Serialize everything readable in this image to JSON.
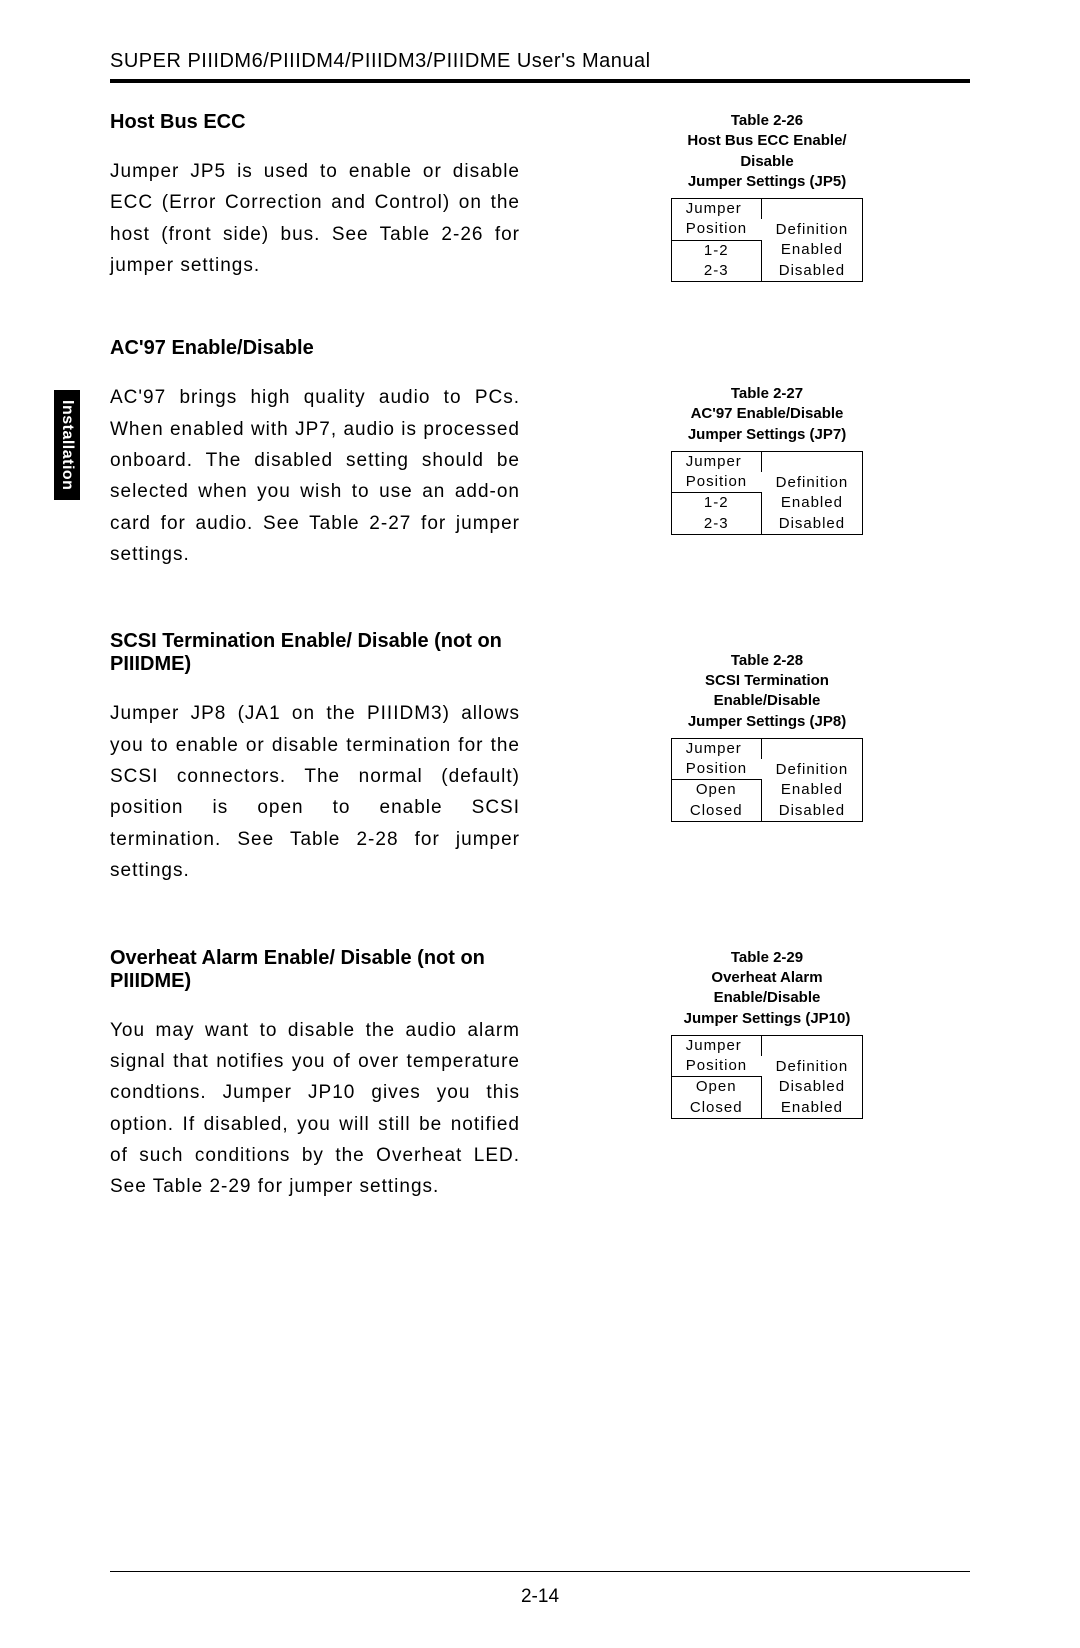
{
  "header": "SUPER PIIIDM6/PIIIDM4/PIIIDM3/PIIIDME User's Manual",
  "side_tab": "Installation",
  "page_number": "2-14",
  "sections": [
    {
      "title": "Host Bus ECC",
      "body": "Jumper JP5 is used to enable or disable ECC (Error Correction and Control) on the host (front side) bus.  See Table 2-26 for jumper settings."
    },
    {
      "title": "AC'97 Enable/Disable",
      "body": "AC'97 brings high quality audio to PCs.  When enabled with JP7, audio is processed onboard.  The disabled setting should be selected when you wish to use an add-on card for audio.  See Table 2-27 for jumper settings."
    },
    {
      "title": "SCSI Termination Enable/ Disable (not on PIIIDME)",
      "body": "Jumper JP8 (JA1 on the PIIIDM3) allows you to enable or disable termination for the SCSI connectors.  The normal (default) position is open to enable SCSI termination.  See Table 2-28 for jumper settings."
    },
    {
      "title": "Overheat Alarm Enable/ Disable (not on PIIIDME)",
      "body": "You may want to disable the audio alarm signal that notifies you of over temperature condtions.  Jumper JP10 gives you this option.  If disabled, you will still be notified of such conditions by the Overheat LED.  See Table 2-29 for jumper settings."
    }
  ],
  "tables": [
    {
      "caption_lines": [
        "Table 2-26",
        "Host Bus ECC Enable/",
        "Disable",
        "Jumper Settings (JP5)"
      ],
      "header": [
        "Jumper Position",
        "Definition"
      ],
      "rows": [
        [
          "1-2",
          "Enabled"
        ],
        [
          "2-3",
          "Disabled"
        ]
      ]
    },
    {
      "caption_lines": [
        "Table 2-27",
        "AC'97 Enable/Disable",
        "Jumper Settings (JP7)"
      ],
      "header": [
        "Jumper Position",
        "Definition"
      ],
      "rows": [
        [
          "1-2",
          "Enabled"
        ],
        [
          "2-3",
          "Disabled"
        ]
      ]
    },
    {
      "caption_lines": [
        "Table 2-28",
        "SCSI Termination",
        "Enable/Disable",
        "Jumper Settings (JP8)"
      ],
      "header": [
        "Jumper Position",
        "Definition"
      ],
      "rows": [
        [
          "Open",
          "Enabled"
        ],
        [
          "Closed",
          "Disabled"
        ]
      ]
    },
    {
      "caption_lines": [
        "Table 2-29",
        "Overheat Alarm",
        "Enable/Disable",
        "Jumper Settings (JP10)"
      ],
      "header": [
        "Jumper Position",
        "Definition"
      ],
      "rows": [
        [
          "Open",
          "Disabled"
        ],
        [
          "Closed",
          "Enabled"
        ]
      ]
    }
  ]
}
